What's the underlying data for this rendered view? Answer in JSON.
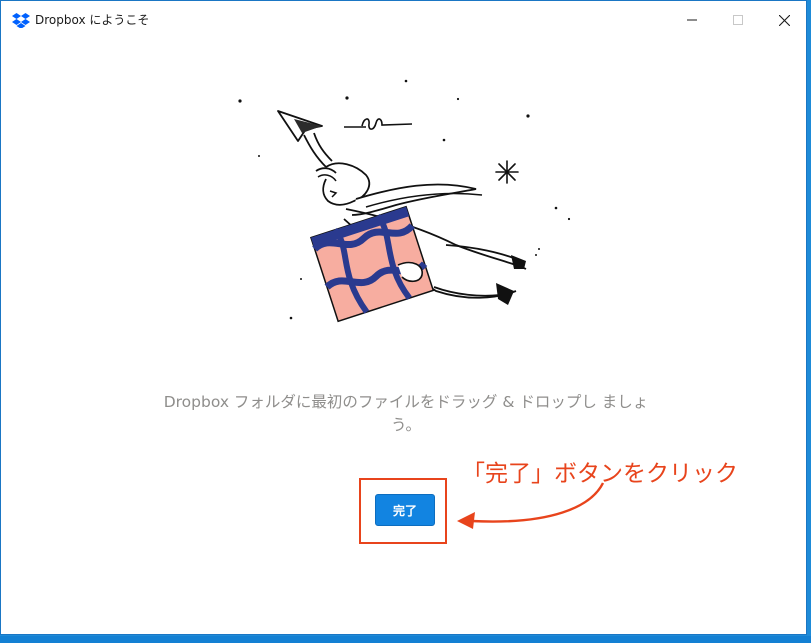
{
  "window": {
    "title": "Dropbox にようこそ",
    "app_icon": "dropbox-icon",
    "controls": [
      "minimize-icon",
      "maximize-icon",
      "close-icon"
    ]
  },
  "main": {
    "illustration": "person-flying-with-paper-plane-and-box",
    "message": "Dropbox フォルダに最初のファイルをドラッグ & ドロップし ましょう。",
    "done_label": "完了"
  },
  "annotation": {
    "text": "「完了」ボタンをクリック",
    "color": "#e8441c"
  },
  "colors": {
    "accent": "#1284e1",
    "annotation": "#e8441c",
    "message_text": "#8f8e8c"
  }
}
